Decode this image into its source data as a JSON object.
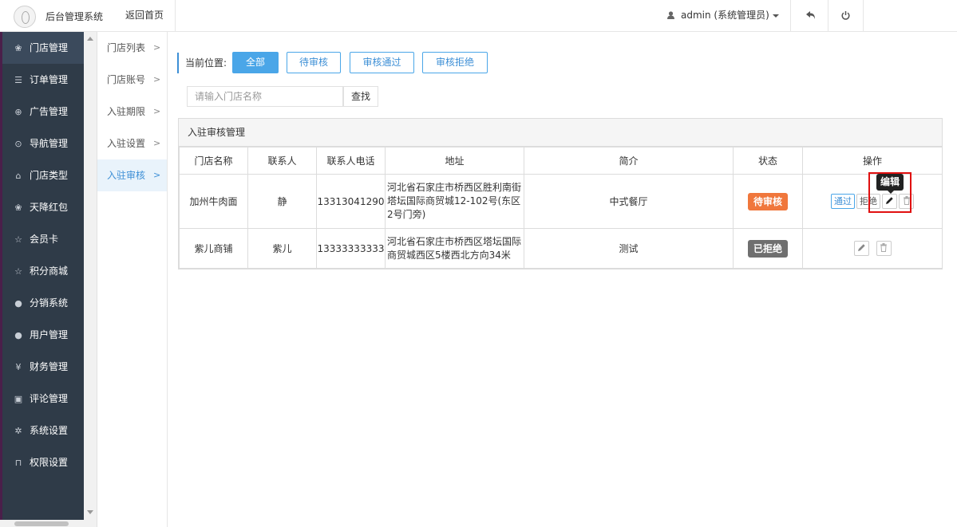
{
  "header": {
    "system_title": "后台管理系统",
    "back_home": "返回首页",
    "user": "admin (系统管理员)"
  },
  "sidebar": {
    "items": [
      {
        "label": "门店管理",
        "icon": "store-icon",
        "active": true
      },
      {
        "label": "订单管理",
        "icon": "list-icon",
        "active": false
      },
      {
        "label": "广告管理",
        "icon": "lifebuoy-icon",
        "active": false
      },
      {
        "label": "导航管理",
        "icon": "compass-icon",
        "active": false
      },
      {
        "label": "门店类型",
        "icon": "bank-icon",
        "active": false
      },
      {
        "label": "天降红包",
        "icon": "gift-icon",
        "active": false
      },
      {
        "label": "会员卡",
        "icon": "star-icon",
        "active": false
      },
      {
        "label": "积分商城",
        "icon": "star-icon",
        "active": false
      },
      {
        "label": "分销系统",
        "icon": "users-icon",
        "active": false
      },
      {
        "label": "用户管理",
        "icon": "user-icon",
        "active": false
      },
      {
        "label": "财务管理",
        "icon": "yen-icon",
        "active": false
      },
      {
        "label": "评论管理",
        "icon": "money-icon",
        "active": false
      },
      {
        "label": "系统设置",
        "icon": "gear-icon",
        "active": false
      },
      {
        "label": "权限设置",
        "icon": "lock-icon",
        "active": false
      }
    ]
  },
  "subnav": {
    "items": [
      {
        "label": "门店列表",
        "active": false
      },
      {
        "label": "门店账号",
        "active": false
      },
      {
        "label": "入驻期限",
        "active": false
      },
      {
        "label": "入驻设置",
        "active": false
      },
      {
        "label": "入驻审核",
        "active": true
      }
    ]
  },
  "content": {
    "breadcrumb": "当前位置:",
    "filters": [
      {
        "label": "全部",
        "active": true
      },
      {
        "label": "待审核",
        "active": false
      },
      {
        "label": "审核通过",
        "active": false
      },
      {
        "label": "审核拒绝",
        "active": false
      }
    ],
    "search": {
      "placeholder": "请输入门店名称",
      "button": "查找"
    },
    "panel_title": "入驻审核管理",
    "table": {
      "headers": [
        "门店名称",
        "联系人",
        "联系人电话",
        "地址",
        "简介",
        "状态",
        "操作"
      ],
      "rows": [
        {
          "name": "加州牛肉面",
          "contact": "静",
          "phone": "13313041290",
          "address": "河北省石家庄市桥西区胜利南街塔坛国际商贸城12-102号(东区2号门旁)",
          "intro": "中式餐厅",
          "status": "待审核"
        },
        {
          "name": "紫儿商铺",
          "contact": "紫儿",
          "phone": "13333333333",
          "address": "河北省石家庄市桥西区塔坛国际商贸城西区5楼西北方向34米",
          "intro": "测试",
          "status": "已拒绝"
        }
      ],
      "actions": {
        "pass": "通过",
        "reject": "拒绝"
      }
    },
    "tooltip": "编辑"
  },
  "colors": {
    "sidebar_bg": "#2f3b48",
    "accent": "#4aa6e8",
    "status_pending": "#f0773c",
    "status_rejected": "#6f6f6f",
    "highlight": "#e01010"
  }
}
